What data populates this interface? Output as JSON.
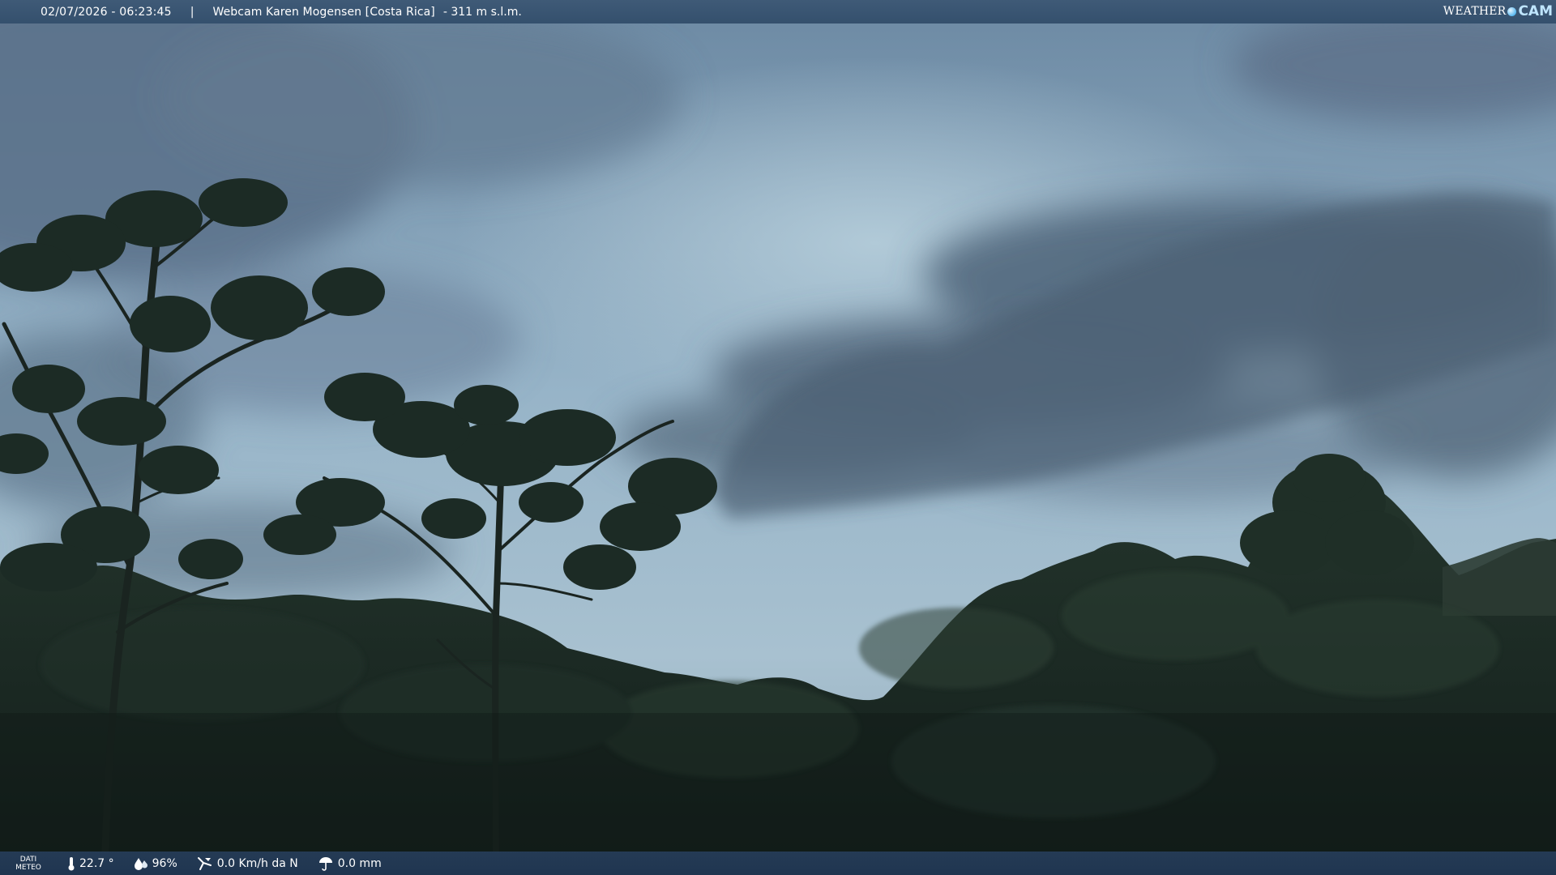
{
  "header": {
    "datetime": "02/07/2026 - 06:23:45",
    "separator": "|",
    "title": "Webcam Karen Mogensen [Costa Rica]",
    "altitude": "- 311 m s.l.m."
  },
  "logo": {
    "word": "WEATHER",
    "suffix": "CAM",
    "colors": {
      "accent": "#58b8f0"
    }
  },
  "weather": {
    "label_line1": "DATI",
    "label_line2": "METEO",
    "temperature": "22.7 °",
    "humidity": "96%",
    "wind": "0.0 Km/h da N",
    "rain": "0.0 mm",
    "icons": {
      "temperature": "thermometer-icon",
      "humidity": "humidity-drop-icon",
      "wind": "wind-icon",
      "rain": "rain-umbrella-icon"
    }
  },
  "colors": {
    "sky_top": "#6f8ea8",
    "sky_bottom": "#a9c3d3",
    "forest": "#1b2a24",
    "bar_top": "#3a5572",
    "bar_bottom": "#233a53"
  }
}
